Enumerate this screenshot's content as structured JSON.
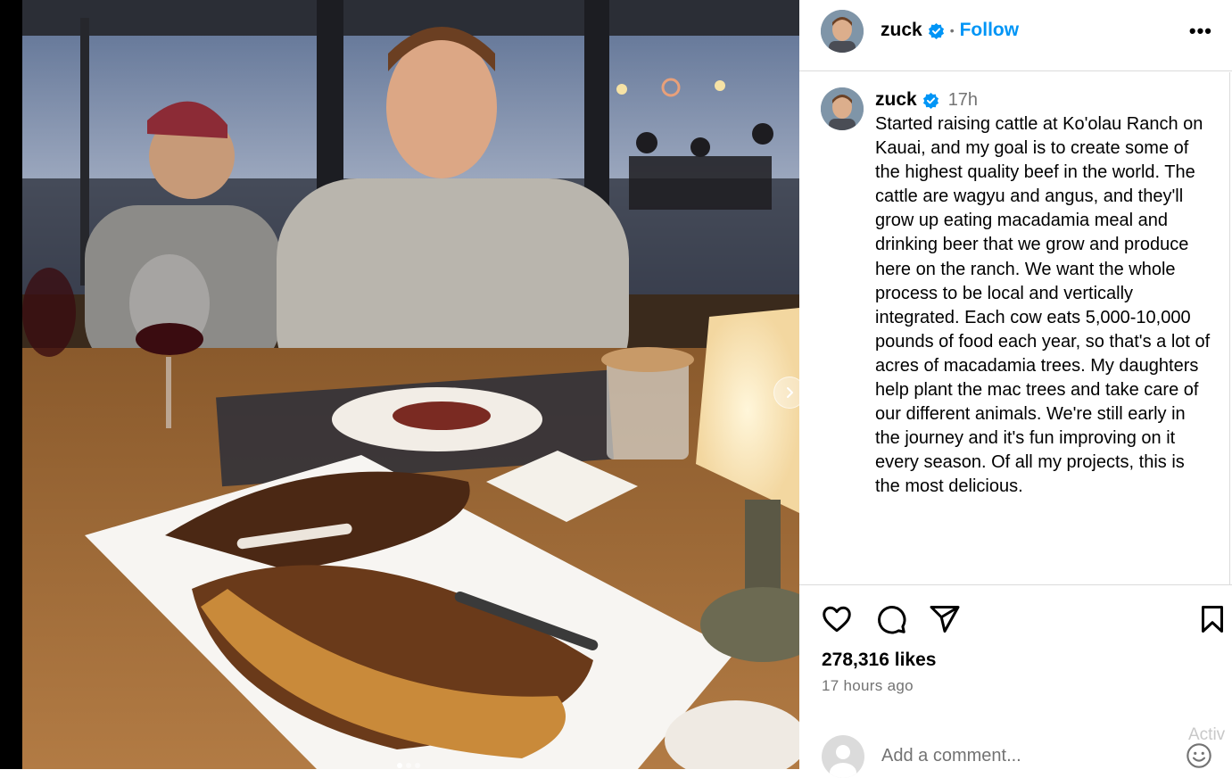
{
  "post": {
    "photo_alt": "Dinner table with steaks",
    "author": {
      "username": "zuck",
      "verified": true,
      "follow_label": "Follow",
      "separator": "•",
      "more_label": "•••"
    },
    "caption": {
      "username": "zuck",
      "age": "17h",
      "text": "Started raising cattle at Ko'olau Ranch on Kauai, and my goal is to create some of the highest quality beef in the world. The cattle are wagyu and angus, and they'll grow up eating macadamia meal and drinking beer that we grow and produce here on the ranch. We want the whole process to be local and vertically integrated. Each cow eats 5,000-10,000 pounds of food each year, so that's a lot of acres of macadamia trees. My daughters help plant the mac trees and take care of our different animals. We're still early in the journey and it's fun improving on it every season. Of all my projects, this is the most delicious."
    },
    "likes": "278,316 likes",
    "timestamp": "17 hours ago",
    "comment_placeholder": "Add a comment...",
    "watermark": "Activ"
  },
  "icons": {
    "like": "heart-icon",
    "comment": "comment-icon",
    "share": "send-icon",
    "save": "bookmark-icon",
    "verified": "verified-badge-icon",
    "next": "chevron-right-icon",
    "emoji": "emoji-icon"
  },
  "colors": {
    "link_blue": "#0095f6",
    "verified_blue": "#0095f6",
    "muted": "#737373",
    "border": "#dbdbdb"
  }
}
